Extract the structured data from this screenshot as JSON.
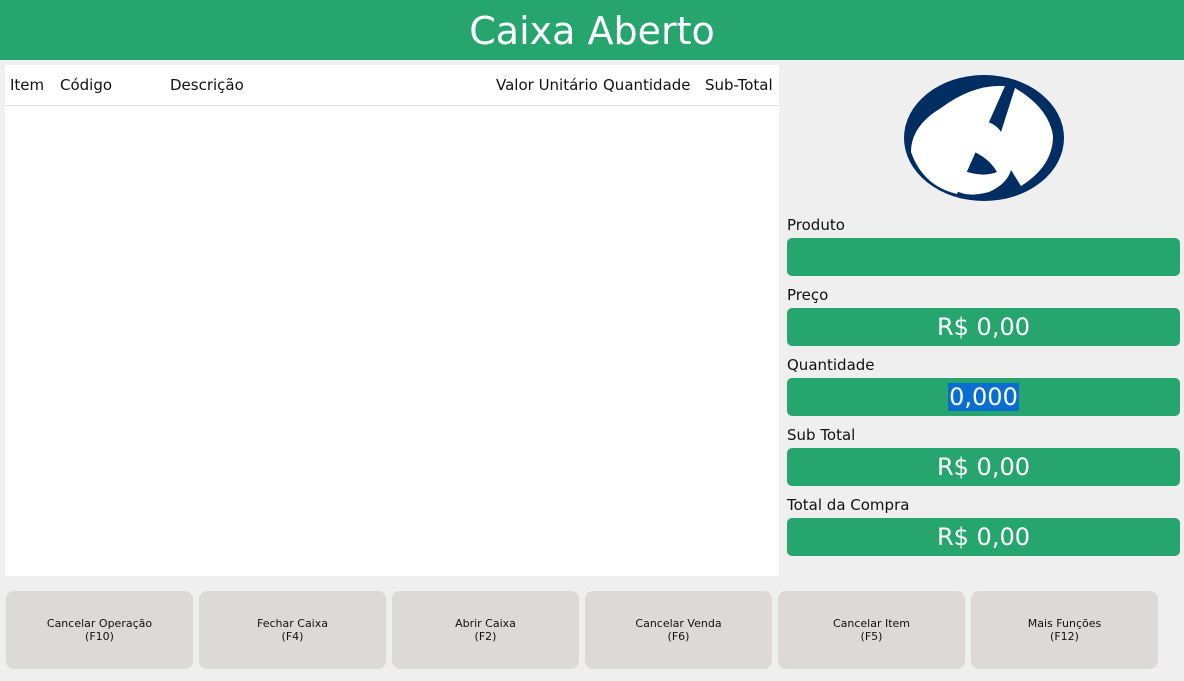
{
  "header": {
    "title": "Caixa Aberto"
  },
  "table": {
    "columns": [
      "Item",
      "Código",
      "Descrição",
      "Valor Unitário",
      "Quantidade",
      "Sub-Total"
    ],
    "rows": []
  },
  "fields": {
    "produto": {
      "label": "Produto",
      "value": ""
    },
    "preco": {
      "label": "Preço",
      "value": "R$ 0,00"
    },
    "quantidade": {
      "label": "Quantidade",
      "value": "0,000"
    },
    "subtotal": {
      "label": "Sub Total",
      "value": "R$ 0,00"
    },
    "total": {
      "label": "Total da Compra",
      "value": "R$ 0,00"
    }
  },
  "buttons": [
    {
      "label": "Cancelar Operação",
      "key": "(F10)"
    },
    {
      "label": "Fechar Caixa",
      "key": "(F4)"
    },
    {
      "label": "Abrir Caixa",
      "key": "(F2)"
    },
    {
      "label": "Cancelar Venda",
      "key": "(F6)"
    },
    {
      "label": "Cancelar Item",
      "key": "(F5)"
    },
    {
      "label": "Mais Funções",
      "key": "(F12)"
    }
  ],
  "colors": {
    "accent": "#27a56e",
    "logo": "#002d62",
    "selection": "#0a6ed1",
    "button": "#ddd9d9"
  },
  "icons": {
    "logo": "company-logo-icon"
  }
}
